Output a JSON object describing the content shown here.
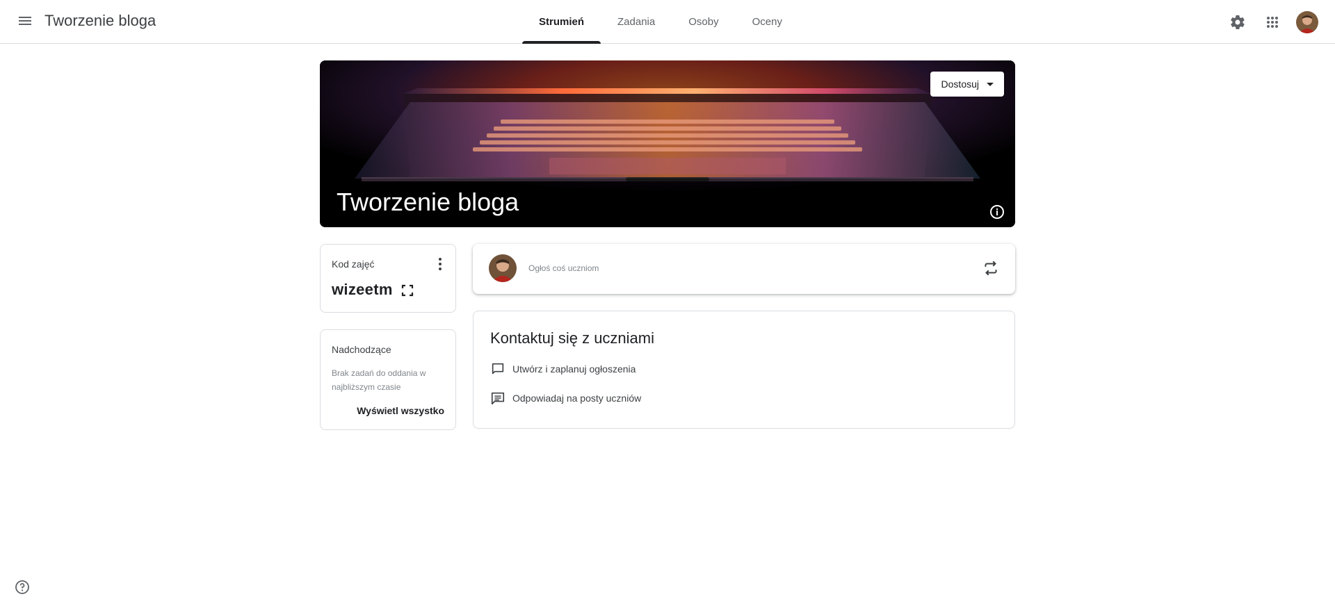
{
  "header": {
    "app_title": "Tworzenie bloga",
    "tabs": [
      {
        "label": "Strumień",
        "active": true
      },
      {
        "label": "Zadania",
        "active": false
      },
      {
        "label": "Osoby",
        "active": false
      },
      {
        "label": "Oceny",
        "active": false
      }
    ],
    "icons": [
      "menu-icon",
      "gear-icon",
      "apps-grid-icon",
      "avatar"
    ]
  },
  "banner": {
    "title": "Tworzenie bloga",
    "customize_label": "Dostosuj"
  },
  "class_code": {
    "label": "Kod zajęć",
    "value": "wizeetm"
  },
  "upcoming": {
    "title": "Nadchodzące",
    "empty_text": "Brak zadań do oddania w najbliższym czasie",
    "view_all_label": "Wyświetl wszystko"
  },
  "announce": {
    "placeholder": "Ogłoś coś uczniom"
  },
  "contact": {
    "title": "Kontaktuj się z uczniami",
    "items": [
      {
        "label": "Utwórz i zaplanuj ogłoszenia",
        "icon": "chat-bubble-icon"
      },
      {
        "label": "Odpowiadaj na posty uczniów",
        "icon": "comment-lines-icon"
      }
    ]
  },
  "colors": {
    "text_primary": "#202124",
    "text_secondary": "#5f6368",
    "border": "#dadce0",
    "banner_bg": "#000000"
  }
}
